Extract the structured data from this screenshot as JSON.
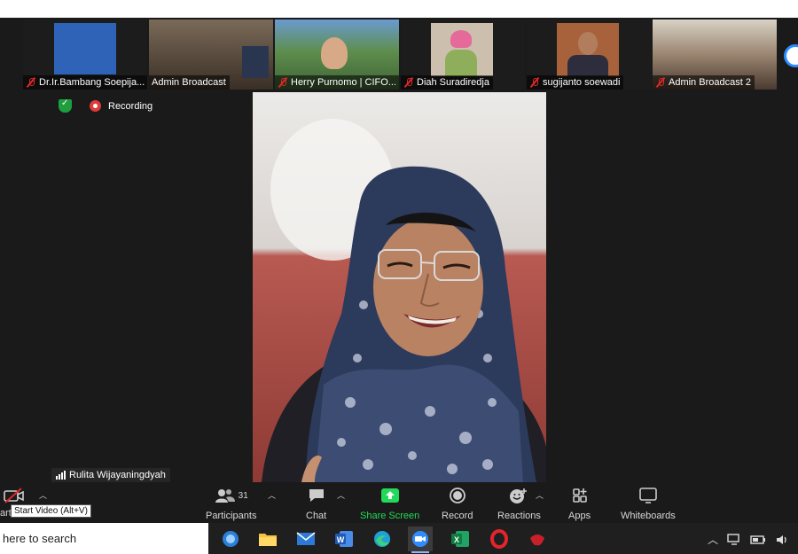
{
  "participants_strip": [
    {
      "name": "Dr.Ir.Bambang Soepija...",
      "muted": true,
      "bg": "#2e63b8"
    },
    {
      "name": "Admin Broadcast",
      "muted": false,
      "bg": "#5a4a3a"
    },
    {
      "name": "Herry Purnomo | CIFO...",
      "muted": true,
      "bg": "#6e8f5a"
    },
    {
      "name": "Diah Suradiredja",
      "muted": true,
      "bg": "#c9b9a4"
    },
    {
      "name": "sugijanto soewadi",
      "muted": true,
      "bg": "#8b5a3c"
    },
    {
      "name": "Admin Broadcast 2",
      "muted": true,
      "bg": "#8e7a64"
    }
  ],
  "status": {
    "recording_label": "Recording"
  },
  "active_speaker": {
    "name": "Rulita Wijayaningdyah"
  },
  "toolbar": {
    "start_video_tooltip": "Start Video (Alt+V)",
    "start_video_partial_label": "art",
    "participants_count": "31",
    "participants_label": "Participants",
    "chat_label": "Chat",
    "share_screen_label": "Share Screen",
    "record_label": "Record",
    "reactions_label": "Reactions",
    "apps_label": "Apps",
    "whiteboards_label": "Whiteboards"
  },
  "taskbar": {
    "search_text": "here to search"
  },
  "colors": {
    "share_green": "#23d959",
    "mute_red": "#e02828",
    "accent_blue": "#2d8cff"
  }
}
